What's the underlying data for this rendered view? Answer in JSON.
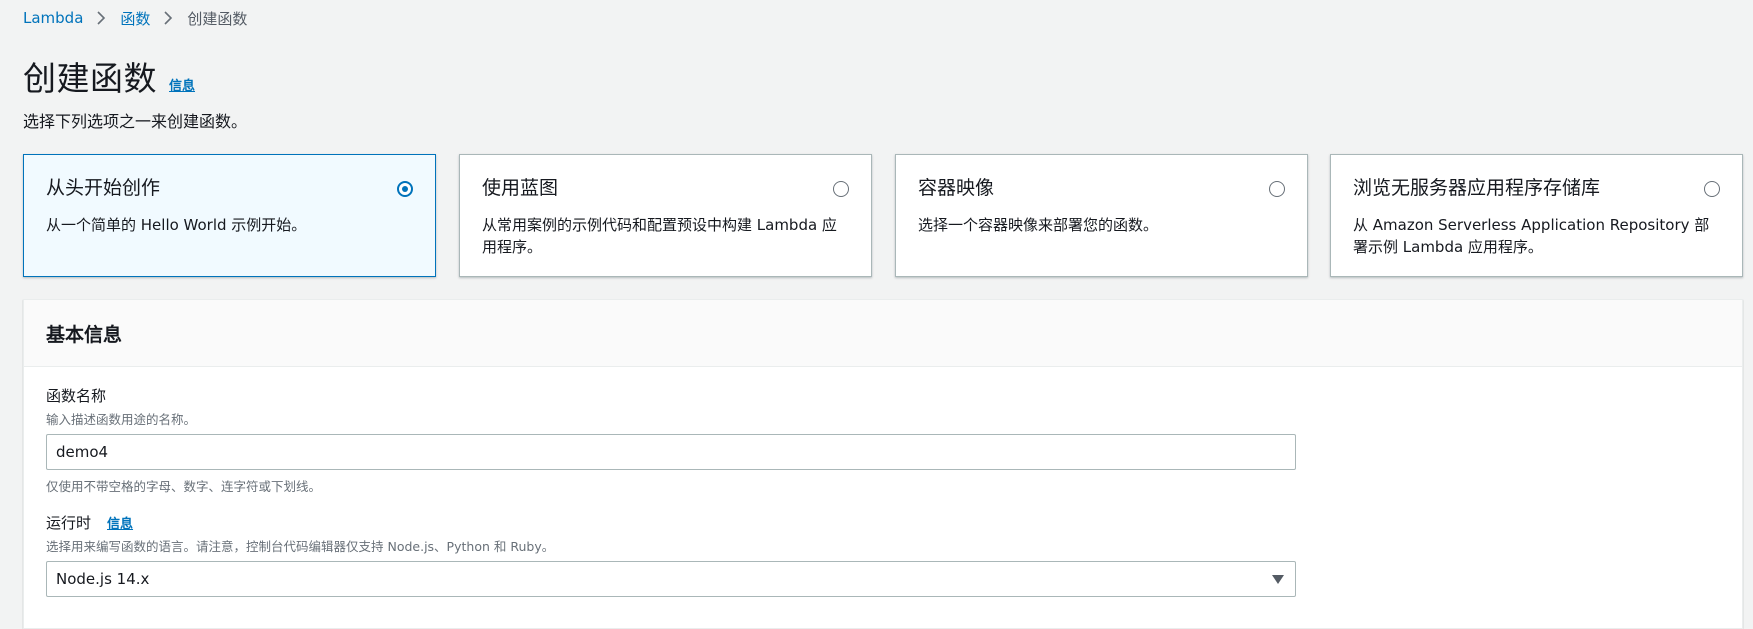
{
  "breadcrumb": {
    "items": [
      "Lambda",
      "函数"
    ],
    "current": "创建函数"
  },
  "page": {
    "title": "创建函数",
    "info_label": "信息",
    "description": "选择下列选项之一来创建函数。"
  },
  "options": [
    {
      "title": "从头开始创作",
      "description": "从一个简单的 Hello World 示例开始。",
      "selected": true
    },
    {
      "title": "使用蓝图",
      "description": "从常用案例的示例代码和配置预设中构建 Lambda 应用程序。",
      "selected": false
    },
    {
      "title": "容器映像",
      "description": "选择一个容器映像来部署您的函数。",
      "selected": false
    },
    {
      "title": "浏览无服务器应用程序存储库",
      "description": "从 Amazon Serverless Application Repository 部署示例 Lambda 应用程序。",
      "selected": false
    }
  ],
  "basic_info": {
    "header": "基本信息",
    "function_name": {
      "label": "函数名称",
      "description": "输入描述函数用途的名称。",
      "value": "demo4",
      "constraint": "仅使用不带空格的字母、数字、连字符或下划线。"
    },
    "runtime": {
      "label": "运行时",
      "info_label": "信息",
      "description": "选择用来编写函数的语言。请注意，控制台代码编辑器仅支持 Node.js、Python 和 Ruby。",
      "value": "Node.js 14.x"
    }
  },
  "colors": {
    "link": "#0073bb",
    "selected_border": "#0073bb",
    "selected_bg": "#f1faff",
    "page_bg": "#f2f3f3"
  },
  "icons": {
    "breadcrumb_separator": "chevron-right-icon",
    "select_caret": "caret-down-icon"
  }
}
